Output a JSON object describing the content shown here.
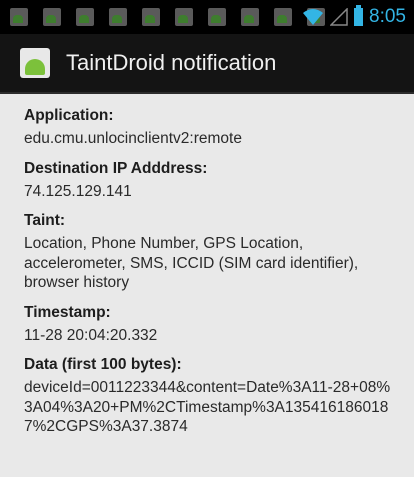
{
  "status_bar": {
    "time": "8:05",
    "notification_icons": [
      "android-icon",
      "android-icon",
      "android-icon",
      "android-icon",
      "android-icon",
      "android-icon",
      "android-icon",
      "android-icon",
      "android-icon",
      "android-icon"
    ]
  },
  "titlebar": {
    "title": "TaintDroid notification"
  },
  "fields": [
    {
      "label": "Application:",
      "value": "edu.cmu.unlocinclientv2:remote"
    },
    {
      "label": "Destination IP Adddress:",
      "value": "74.125.129.141"
    },
    {
      "label": "Taint:",
      "value": "Location, Phone Number, GPS Location, accelerometer, SMS, ICCID (SIM card identifier), browser history"
    },
    {
      "label": "Timestamp:",
      "value": "11-28 20:04:20.332"
    },
    {
      "label": "Data (first 100 bytes):",
      "value": "deviceId=0011223344&content=Date%3A11-28+08%3A04%3A20+PM%2CTimestamp%3A1354161860187%2CGPS%3A37.3874"
    }
  ],
  "colors": {
    "accent": "#33b5e5",
    "titlebar_bg": "#141414",
    "content_bg": "#e9e9e9"
  }
}
